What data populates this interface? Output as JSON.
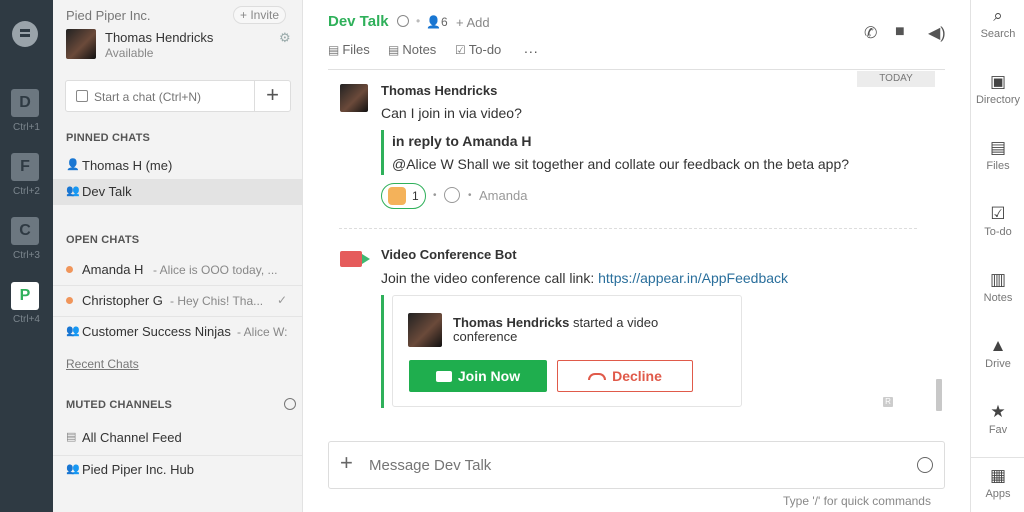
{
  "workspaces": [
    {
      "letter": "D",
      "shortcut": "Ctrl+1"
    },
    {
      "letter": "F",
      "shortcut": "Ctrl+2"
    },
    {
      "letter": "C",
      "shortcut": "Ctrl+3"
    },
    {
      "letter": "P",
      "shortcut": "Ctrl+4"
    }
  ],
  "sidebar": {
    "org_name": "Pied Piper Inc.",
    "invite_label": "+ Invite",
    "user_name": "Thomas Hendricks",
    "user_status": "Available",
    "start_chat_placeholder": "Start a chat (Ctrl+N)",
    "pinned_title": "PINNED CHATS",
    "pinned": [
      {
        "name": "Thomas H (me)"
      },
      {
        "name": "Dev Talk"
      }
    ],
    "open_title": "OPEN CHATS",
    "open": [
      {
        "name": "Amanda H",
        "preview": "- Alice is OOO today, ..."
      },
      {
        "name": "Christopher G",
        "preview": "- Hey Chis! Tha..."
      },
      {
        "name": "Customer Success Ninjas",
        "preview": "- Alice W:"
      }
    ],
    "recent_link": "Recent Chats",
    "muted_title": "MUTED CHANNELS",
    "muted": [
      {
        "name": "All Channel Feed"
      },
      {
        "name": "Pied Piper Inc. Hub"
      }
    ]
  },
  "header": {
    "title": "Dev Talk",
    "members": "6",
    "add_label": "+ Add",
    "tools": [
      "Files",
      "Notes",
      "To-do"
    ],
    "more": "..."
  },
  "messages": {
    "today_label": "TODAY",
    "m1": {
      "sender": "Thomas Hendricks",
      "text": "Can I join in via video?",
      "reply_title": "in reply to Amanda H",
      "reply_text": "@Alice W Shall we sit together and collate our feedback on the beta app?",
      "reaction_count": "1",
      "reacted_by": "Amanda"
    },
    "m2": {
      "sender": "Video Conference Bot",
      "text": "Join the video conference call link:",
      "link": "https://appear.in/AppFeedback",
      "card_name": "Thomas Hendricks",
      "card_text": "started a video conference",
      "join_label": "Join Now",
      "decline_label": "Decline",
      "small_badge": "R"
    }
  },
  "composer": {
    "placeholder": "Message Dev Talk",
    "hint": "Type '/' for quick commands"
  },
  "right_rail": [
    {
      "label": "Search",
      "icon": "search-icon"
    },
    {
      "label": "Directory",
      "icon": "directory-icon"
    },
    {
      "label": "Files",
      "icon": "files-icon"
    },
    {
      "label": "To-do",
      "icon": "todo-icon"
    },
    {
      "label": "Notes",
      "icon": "notes-icon"
    },
    {
      "label": "Drive",
      "icon": "drive-icon"
    },
    {
      "label": "Fav",
      "icon": "star-icon"
    },
    {
      "label": "Apps",
      "icon": "apps-icon"
    }
  ],
  "colors": {
    "accent": "#2fb05a",
    "rail": "#2f3a43",
    "decline": "#e05a4a",
    "link": "#2a6f9c"
  }
}
